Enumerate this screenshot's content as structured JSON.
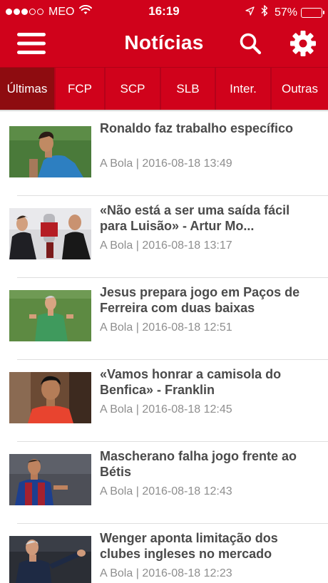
{
  "status_bar": {
    "carrier": "MEO",
    "time": "16:19",
    "battery_percent": "57%",
    "battery_level": 0.57,
    "icons": [
      "signal-dots-icon",
      "wifi-icon",
      "location-arrow-icon",
      "bluetooth-icon",
      "battery-icon"
    ]
  },
  "navbar": {
    "title": "Notícias",
    "icons": [
      "hamburger-menu-icon",
      "search-icon",
      "gear-icon"
    ]
  },
  "tabs": [
    {
      "label": "Últimas",
      "active": true
    },
    {
      "label": "FCP",
      "active": false
    },
    {
      "label": "SCP",
      "active": false
    },
    {
      "label": "SLB",
      "active": false
    },
    {
      "label": "Inter.",
      "active": false
    },
    {
      "label": "Outras",
      "active": false
    }
  ],
  "news": [
    {
      "title": "Ronaldo faz trabalho específico",
      "source": "A Bola",
      "datetime": "2016-08-18 13:49"
    },
    {
      "title": "«Não está a ser uma saída fácil para Luisão» - Artur Mo...",
      "source": "A Bola",
      "datetime": "2016-08-18 13:17"
    },
    {
      "title": "Jesus prepara jogo em Paços de Ferreira com duas baixas",
      "source": "A Bola",
      "datetime": "2016-08-18 12:51"
    },
    {
      "title": "«Vamos honrar a camisola do Benfica» - Franklin",
      "source": "A Bola",
      "datetime": "2016-08-18 12:45"
    },
    {
      "title": "Mascherano falha jogo frente ao Bétis",
      "source": "A Bola",
      "datetime": "2016-08-18 12:43"
    },
    {
      "title": "Wenger aponta limitação dos clubes ingleses no mercado",
      "source": "A Bola",
      "datetime": "2016-08-18 12:23"
    }
  ],
  "meta_separator": " | ",
  "colors": {
    "brand_red": "#d0021b",
    "active_tab": "#8e0c10",
    "title_text": "#4a4a4a",
    "meta_text": "#8e8e8e"
  }
}
